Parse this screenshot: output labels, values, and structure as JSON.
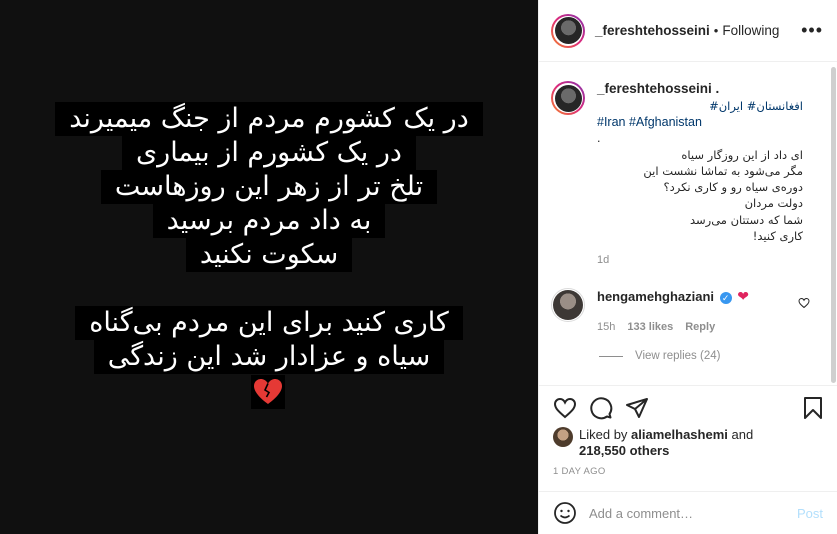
{
  "story": {
    "lines": [
      "در یک کشورم مردم از جنگ میمیرند",
      "در یک کشورم از بیماری",
      "تلخ تر از زهر این روزهاست",
      "به داد مردم برسید",
      "سکوت نکنید",
      "کاری کنید برای این مردم بی‌گناه",
      "سیاه و عزادار شد این زندگی"
    ],
    "emoji": "💔"
  },
  "header": {
    "username": "_fereshtehosseini",
    "separator": "•",
    "follow_status": "Following",
    "more": "•••"
  },
  "caption": {
    "username": "_fereshtehosseini .",
    "tags_fa": "افغانستان# ایران#",
    "tags_en": "#Iran #Afghanistan",
    "dot": ".",
    "lines": [
      "ای داد از این روزگار سیاه",
      "مگر می‌شود به تماشا نشست این",
      "دوره‌ی سیاه رو و کاری نکرد؟",
      "دولت مردان",
      "شما که دستتان می‌رسد",
      "کاری کنید!"
    ],
    "time": "1d"
  },
  "comment": {
    "username": "hengamehghaziani",
    "verified": "✓",
    "heart": "❤",
    "time": "15h",
    "likes": "133 likes",
    "reply": "Reply",
    "view_replies": "View replies (24)"
  },
  "likes": {
    "prefix": "Liked by",
    "user": "aliamelhashemi",
    "and": "and",
    "others": "218,550 others"
  },
  "post_age": "1 DAY AGO",
  "add_comment": {
    "placeholder": "Add a comment…",
    "post_label": "Post"
  }
}
